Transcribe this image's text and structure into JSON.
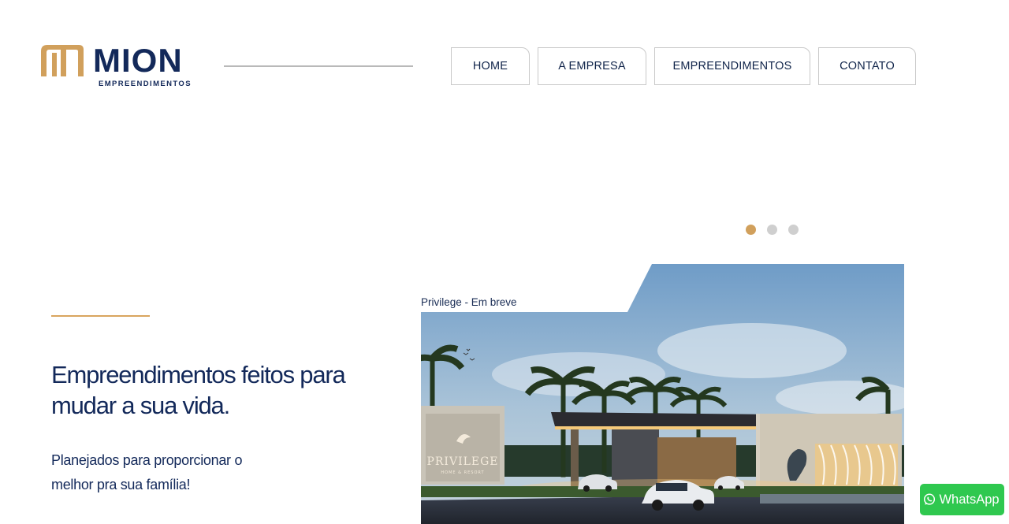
{
  "brand": {
    "name": "MION",
    "tagline": "EMPREENDIMENTOS",
    "colors": {
      "navy": "#13295a",
      "gold": "#d1a05c"
    }
  },
  "nav": {
    "items": [
      {
        "label": "HOME"
      },
      {
        "label": "A EMPRESA"
      },
      {
        "label": "EMPREENDIMENTOS"
      },
      {
        "label": "CONTATO"
      }
    ]
  },
  "carousel": {
    "slide_count": 3,
    "active_index": 0
  },
  "hero": {
    "title": "Empreendimentos feitos para mudar a sua vida.",
    "subtitle": "Planejados para proporcionar o melhor pra sua família!",
    "image_caption": "Privilege - Em breve",
    "image_sign": {
      "name": "PRIVILEGE",
      "sub": "HOME & RESORT"
    }
  },
  "whatsapp": {
    "label": "WhatsApp",
    "icon": "whatsapp-icon",
    "color": "#2fc84f"
  }
}
